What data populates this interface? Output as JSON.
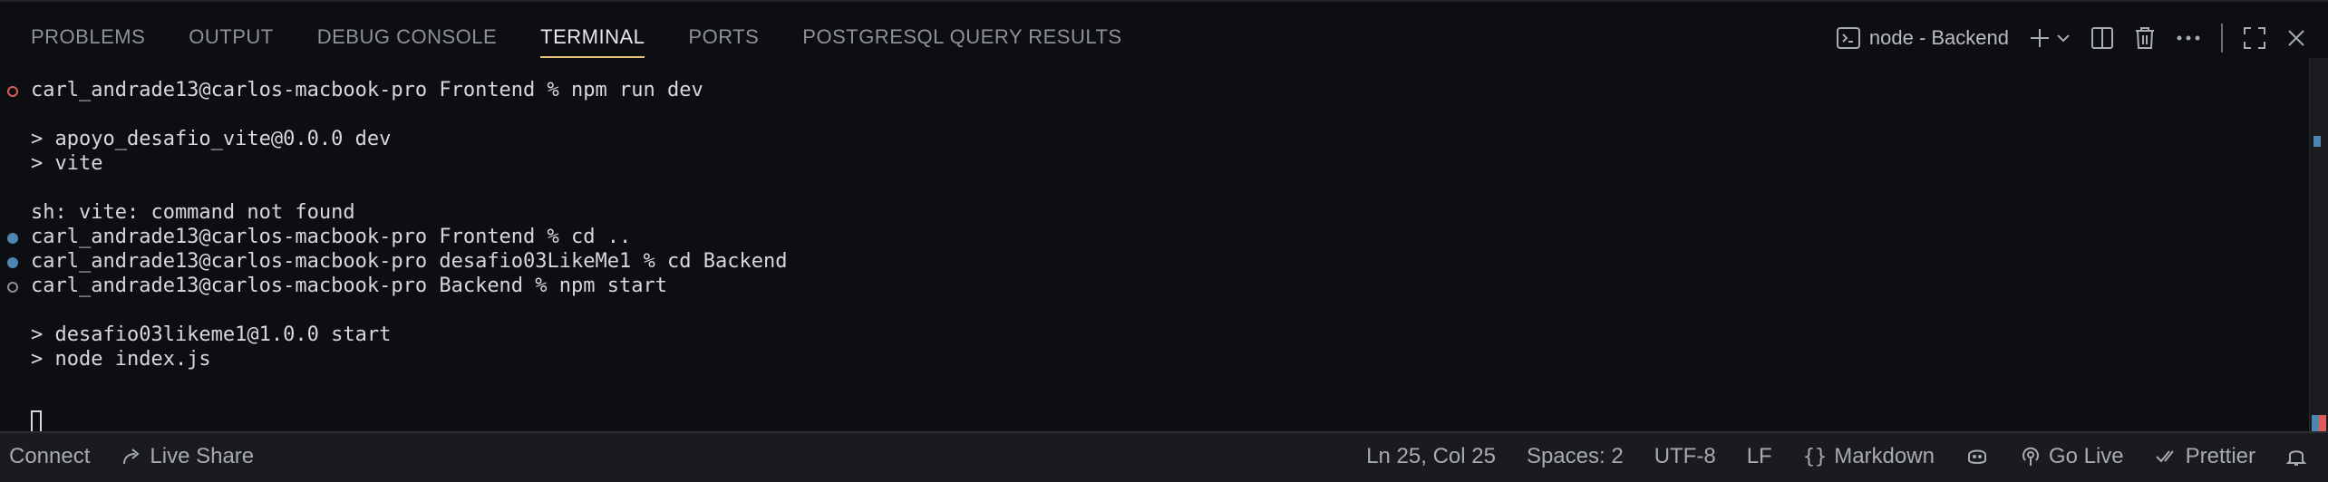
{
  "tabs": [
    {
      "label": "PROBLEMS",
      "active": false
    },
    {
      "label": "OUTPUT",
      "active": false
    },
    {
      "label": "DEBUG CONSOLE",
      "active": false
    },
    {
      "label": "TERMINAL",
      "active": true
    },
    {
      "label": "PORTS",
      "active": false
    },
    {
      "label": "POSTGRESQL QUERY RESULTS",
      "active": false
    }
  ],
  "actions": {
    "terminal_name": "node - Backend",
    "icons": [
      "terminal-icon",
      "add-icon",
      "chevron-down-icon",
      "split-icon",
      "trash-icon",
      "more-icon",
      "maximize-icon",
      "close-icon"
    ]
  },
  "terminal": {
    "lines": [
      {
        "text": "carl_andrade13@carlos-macbook-pro Frontend % npm run dev",
        "marker": "error"
      },
      {
        "text": "",
        "marker": ""
      },
      {
        "text": "> apoyo_desafio_vite@0.0.0 dev",
        "marker": ""
      },
      {
        "text": "> vite",
        "marker": ""
      },
      {
        "text": "",
        "marker": ""
      },
      {
        "text": "sh: vite: command not found",
        "marker": ""
      },
      {
        "text": "carl_andrade13@carlos-macbook-pro Frontend % cd ..",
        "marker": "success"
      },
      {
        "text": "carl_andrade13@carlos-macbook-pro desafio03LikeMe1 % cd Backend",
        "marker": "success"
      },
      {
        "text": "carl_andrade13@carlos-macbook-pro Backend % npm start",
        "marker": "pending"
      },
      {
        "text": "",
        "marker": ""
      },
      {
        "text": "> desafio03likeme1@1.0.0 start",
        "marker": ""
      },
      {
        "text": "> node index.js",
        "marker": ""
      }
    ]
  },
  "statusbar": {
    "connect": "Connect",
    "live_share": "Live Share",
    "position": "Ln 25, Col 25",
    "spaces": "Spaces: 2",
    "encoding": "UTF-8",
    "eol": "LF",
    "language": "Markdown",
    "go_live": "Go Live",
    "prettier": "Prettier"
  },
  "colors": {
    "accent_tab": "#e6c07b",
    "error": "#e05a5a",
    "success": "#4d86b0"
  }
}
